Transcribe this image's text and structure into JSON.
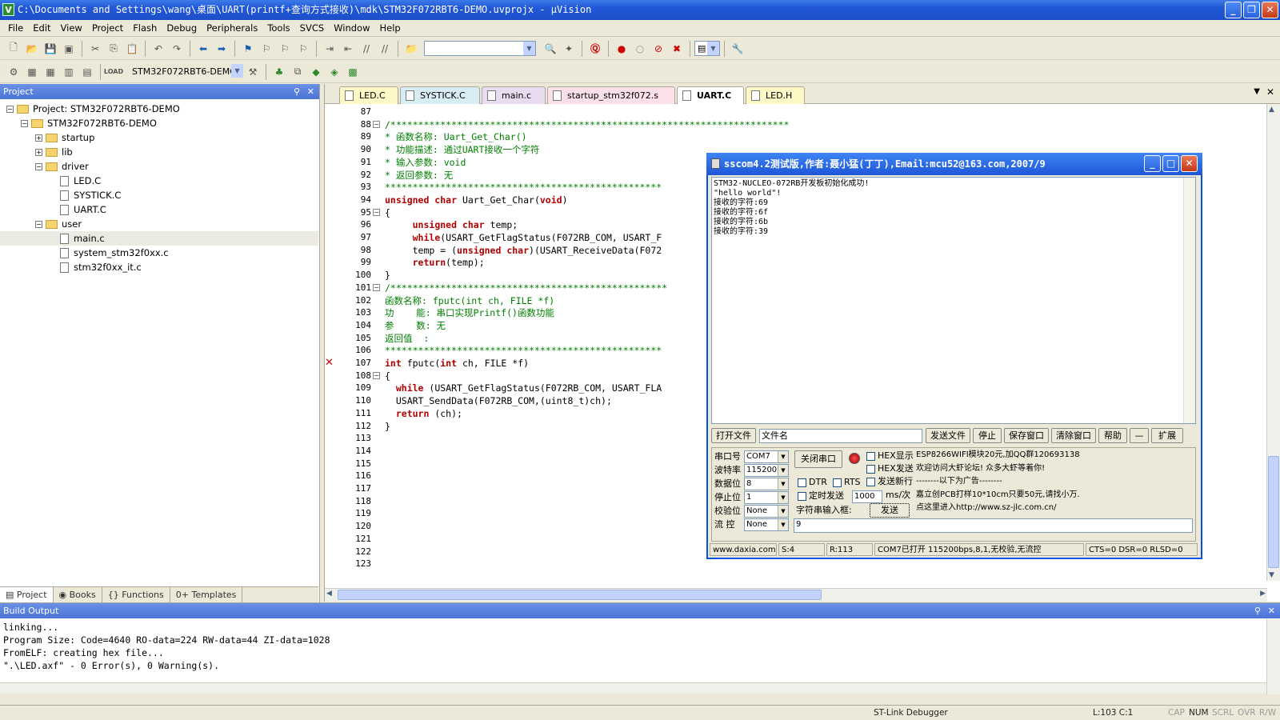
{
  "title": "C:\\Documents and Settings\\wang\\桌面\\UART(printf+查询方式接收)\\mdk\\STM32F072RBT6-DEMO.uvprojx - µVision",
  "menu": [
    "File",
    "Edit",
    "View",
    "Project",
    "Flash",
    "Debug",
    "Peripherals",
    "Tools",
    "SVCS",
    "Window",
    "Help"
  ],
  "toolbar": {
    "target": "STM32F072RBT6-DEMO"
  },
  "project": {
    "header": "Project",
    "tree": [
      {
        "label": "Project: STM32F072RBT6-DEMO",
        "level": 0,
        "kind": "root",
        "pm": "-"
      },
      {
        "label": "STM32F072RBT6-DEMO",
        "level": 1,
        "kind": "folder",
        "pm": "-"
      },
      {
        "label": "startup",
        "level": 2,
        "kind": "folder",
        "pm": "+"
      },
      {
        "label": "lib",
        "level": 2,
        "kind": "folder",
        "pm": "+"
      },
      {
        "label": "driver",
        "level": 2,
        "kind": "folder",
        "pm": "-"
      },
      {
        "label": "LED.C",
        "level": 3,
        "kind": "file"
      },
      {
        "label": "SYSTICK.C",
        "level": 3,
        "kind": "file"
      },
      {
        "label": "UART.C",
        "level": 3,
        "kind": "file"
      },
      {
        "label": "user",
        "level": 2,
        "kind": "folder",
        "pm": "-"
      },
      {
        "label": "main.c",
        "level": 3,
        "kind": "file",
        "selected": true
      },
      {
        "label": "system_stm32f0xx.c",
        "level": 3,
        "kind": "file"
      },
      {
        "label": "stm32f0xx_it.c",
        "level": 3,
        "kind": "file"
      }
    ],
    "tabs": [
      "Project",
      "Books",
      "{} Functions",
      "0+ Templates"
    ]
  },
  "editor": {
    "tabs": [
      "LED.C",
      "SYSTICK.C",
      "main.c",
      "startup_stm32f072.s",
      "UART.C",
      "LED.H"
    ],
    "active_tab": "UART.C",
    "lines": [
      {
        "n": "87",
        "t": ""
      },
      {
        "n": "88",
        "t": "/************************************************************************",
        "c": "cm",
        "f": "-"
      },
      {
        "n": "89",
        "t": "* 函数名称: Uart_Get_Char()",
        "c": "cm"
      },
      {
        "n": "90",
        "t": "* 功能描述: 通过UART接收一个字符",
        "c": "cm"
      },
      {
        "n": "91",
        "t": "* 输入参数: void",
        "c": "cm"
      },
      {
        "n": "92",
        "t": "* 返回参数: 无",
        "c": "cm"
      },
      {
        "n": "93",
        "t": "**************************************************",
        "c": "cm"
      },
      {
        "n": "94",
        "parts": [
          [
            "unsigned char",
            "kw"
          ],
          [
            " Uart_Get_Char(",
            ""
          ],
          [
            "void",
            "kw"
          ],
          [
            ")",
            ""
          ]
        ]
      },
      {
        "n": "95",
        "t": "{",
        "f": "-"
      },
      {
        "n": "96",
        "parts": [
          [
            "     ",
            ""
          ],
          [
            "unsigned char",
            "kw"
          ],
          [
            " temp;",
            ""
          ]
        ]
      },
      {
        "n": "97",
        "parts": [
          [
            "     ",
            ""
          ],
          [
            "while",
            "kw"
          ],
          [
            "(USART_GetFlagStatus(F072RB_COM, USART_F",
            ""
          ]
        ]
      },
      {
        "n": "98",
        "parts": [
          [
            "     temp = (",
            ""
          ],
          [
            "unsigned char",
            "kw"
          ],
          [
            ")(USART_ReceiveData(F072",
            ""
          ]
        ]
      },
      {
        "n": "99",
        "parts": [
          [
            "     ",
            ""
          ],
          [
            "return",
            "kw"
          ],
          [
            "(temp);",
            ""
          ]
        ]
      },
      {
        "n": "100",
        "t": "}"
      },
      {
        "n": "101",
        "t": "/**************************************************",
        "c": "cm",
        "f": "-"
      },
      {
        "n": "102",
        "t": "函数名称: fputc(int ch, FILE *f)",
        "c": "cm"
      },
      {
        "n": "103",
        "t": "功    能: 串口实现Printf()函数功能",
        "c": "cm"
      },
      {
        "n": "104",
        "t": "参    数: 无",
        "c": "cm"
      },
      {
        "n": "105",
        "t": "返回值  :",
        "c": "cm"
      },
      {
        "n": "106",
        "t": "**************************************************",
        "c": "cm"
      },
      {
        "n": "107",
        "parts": [
          [
            "int",
            "kw"
          ],
          [
            " fputc(",
            ""
          ],
          [
            "int",
            "kw"
          ],
          [
            " ch, FILE *f)",
            ""
          ]
        ],
        "mark": "✕"
      },
      {
        "n": "108",
        "t": "{",
        "f": "-"
      },
      {
        "n": "109",
        "parts": [
          [
            "  ",
            ""
          ],
          [
            "while",
            "kw"
          ],
          [
            " (USART_GetFlagStatus(F072RB_COM, USART_FLA",
            ""
          ]
        ]
      },
      {
        "n": "110",
        "t": "  USART_SendData(F072RB_COM,(uint8_t)ch);"
      },
      {
        "n": "111",
        "parts": [
          [
            "  ",
            ""
          ],
          [
            "return",
            "kw"
          ],
          [
            " (ch);",
            ""
          ]
        ]
      },
      {
        "n": "112",
        "t": "}"
      },
      {
        "n": "113",
        "t": ""
      },
      {
        "n": "114",
        "t": ""
      },
      {
        "n": "115",
        "t": ""
      },
      {
        "n": "116",
        "t": ""
      },
      {
        "n": "117",
        "t": ""
      },
      {
        "n": "118",
        "t": ""
      },
      {
        "n": "119",
        "t": ""
      },
      {
        "n": "120",
        "t": ""
      },
      {
        "n": "121",
        "t": ""
      },
      {
        "n": "122",
        "t": ""
      },
      {
        "n": "123",
        "t": ""
      }
    ]
  },
  "build": {
    "header": "Build Output",
    "lines": [
      "linking...",
      "Program Size: Code=4640 RO-data=224 RW-data=44 ZI-data=1028",
      "FromELF: creating hex file...",
      "\".\\LED.axf\" - 0 Error(s), 0 Warning(s)."
    ]
  },
  "status": {
    "debugger": "ST-Link Debugger",
    "pos": "L:103 C:1",
    "caps": "CAP",
    "num": "NUM",
    "scrl": "SCRL",
    "ovr": "OVR",
    "rw": "R/W"
  },
  "sscom": {
    "title": "sscom4.2测试版,作者:聂小猛(丁丁),Email:mcu52@163.com,2007/9",
    "recv": [
      "STM32-NUCLEO-072RB开发板初始化成功!",
      "\"hello world\"!",
      "接收的字符:69",
      "接收的字符:6f",
      "接收的字符:6b",
      "接收的字符:39"
    ],
    "btn_open_file": "打开文件",
    "filename": "文件名",
    "btn_send_file": "发送文件",
    "btn_stop": "停止",
    "btn_save": "保存窗口",
    "btn_clear": "清除窗口",
    "btn_help": "帮助",
    "btn_min": "—",
    "btn_expand": "扩展",
    "lbl_port": "串口号",
    "port": "COM7",
    "btn_close_port": "关闭串口",
    "lbl_hexshow": "HEX显示",
    "lbl_baud": "波特率",
    "baud": "115200",
    "lbl_hexsend": "HEX发送",
    "lbl_data": "数据位",
    "databits": "8",
    "lbl_dtr": "DTR",
    "lbl_rts": "RTS",
    "lbl_newline": "发送新行",
    "lbl_stop": "停止位",
    "stopbits": "1",
    "lbl_timed": "定时发送",
    "interval": "1000",
    "lbl_unit": "ms/次",
    "lbl_parity": "校验位",
    "parity": "None",
    "lbl_input": "字符串输入框:",
    "btn_send": "发送",
    "lbl_flow": "流 控",
    "flow": "None",
    "input_value": "9",
    "ad": [
      "ESP8266WIFI模块20元,加QQ群120693138",
      "欢迎访问大虾论坛! 众多大虾等着你!",
      "--------以下为广告--------",
      "嘉立创PCB打样10*10cm只要50元,请找小万.",
      "点这里进入http://www.sz-jlc.com.cn/"
    ],
    "status": [
      "www.daxia.com",
      "S:4",
      "R:113",
      "COM7已打开  115200bps,8,1,无校验,无流控",
      "CTS=0 DSR=0 RLSD=0"
    ]
  }
}
